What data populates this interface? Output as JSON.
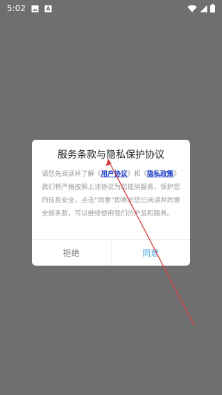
{
  "status_bar": {
    "time": "5:02",
    "icons": [
      "image-icon",
      "a-icon",
      "wifi-icon",
      "signal-icon",
      "battery-icon"
    ]
  },
  "dialog": {
    "title": "服务条款与隐私保护协议",
    "body_segments": [
      {
        "text": "请您先阅读并了解《",
        "link": false
      },
      {
        "text": "用户协议",
        "link": true
      },
      {
        "text": "》和《",
        "link": false
      },
      {
        "text": "隐私政策",
        "link": true
      },
      {
        "text": "》我们将严格按照上述协议为您提供服务，保护您的信息安全，点击“同意”即表示您已阅读并同意全部条款，可以继续使用我们的产品和服务。",
        "link": false
      }
    ],
    "decline_label": "拒绝",
    "agree_label": "同意"
  },
  "colors": {
    "background": "#6f6f6f",
    "link": "#1d3ec6",
    "agree": "#47a2e8",
    "annotation_arrow": "#d23a3a"
  }
}
